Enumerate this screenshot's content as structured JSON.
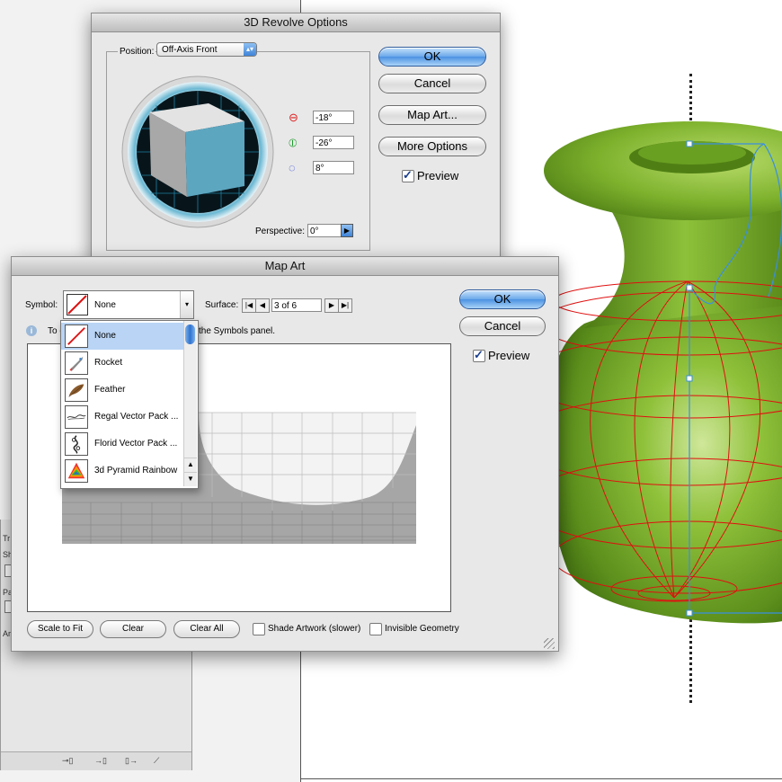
{
  "revolve": {
    "title": "3D Revolve Options",
    "position_label": "Position:",
    "position_value": "Off-Axis Front",
    "x_rotation": "-18°",
    "y_rotation": "-26°",
    "z_rotation": "8°",
    "perspective_label": "Perspective:",
    "perspective_value": "0°",
    "ok": "OK",
    "cancel": "Cancel",
    "map_art": "Map Art...",
    "more_options": "More Options",
    "preview": "Preview"
  },
  "mapart": {
    "title": "Map Art",
    "symbol_label": "Symbol:",
    "symbol_value": "None",
    "surface_label": "Surface:",
    "surface_value": "3 of 6",
    "info_text_left": "To c",
    "info_text_right": "the Symbols panel.",
    "ok": "OK",
    "cancel": "Cancel",
    "preview": "Preview",
    "scale_to_fit": "Scale to Fit",
    "clear": "Clear",
    "clear_all": "Clear All",
    "shade_artwork": "Shade Artwork (slower)",
    "invisible_geometry": "Invisible Geometry",
    "symbols": [
      {
        "label": "None",
        "icon": "none-swatch-icon"
      },
      {
        "label": "Rocket",
        "icon": "rocket-icon"
      },
      {
        "label": "Feather",
        "icon": "feather-icon"
      },
      {
        "label": "Regal Vector Pack ...",
        "icon": "regal-vector-icon"
      },
      {
        "label": "Florid Vector Pack ...",
        "icon": "florid-vector-icon"
      },
      {
        "label": "3d Pyramid Rainbow",
        "icon": "pyramid-rainbow-icon"
      }
    ]
  },
  "background_panel": {
    "row1": "Tr",
    "row2": "Sh",
    "row3": "Pa",
    "row4": "Ar"
  },
  "colors": {
    "vase_green": "#7cb22c",
    "wireframe": "#e01010",
    "selection_path": "#3a8fe0",
    "aqua_blue": "#4b91e2"
  }
}
